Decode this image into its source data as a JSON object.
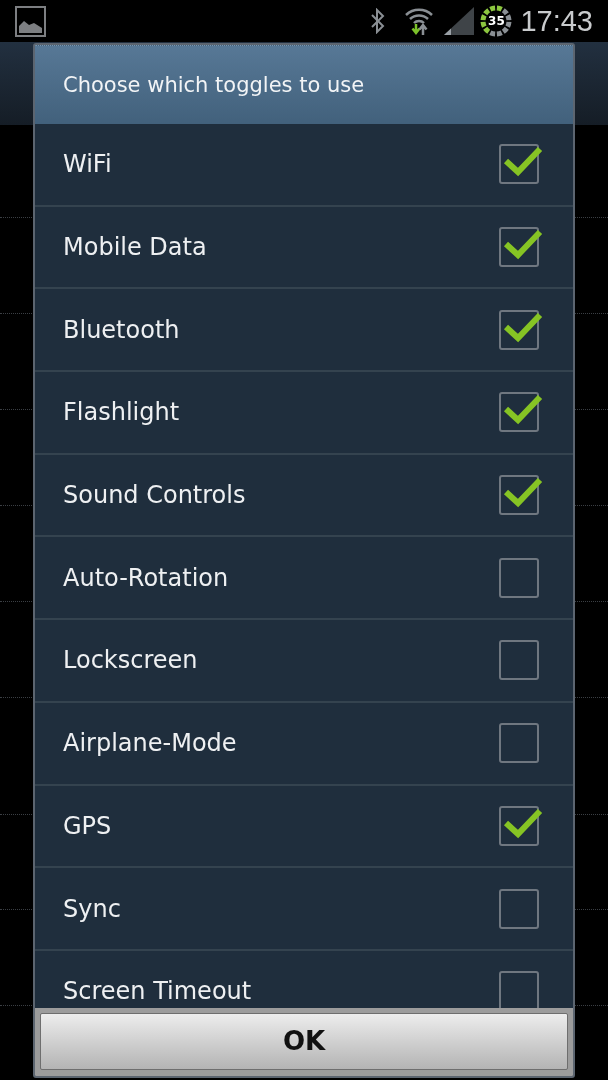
{
  "status_bar": {
    "battery": "35",
    "time": "17:43"
  },
  "dialog": {
    "title": "Choose which toggles to use",
    "toggles": [
      {
        "label": "WiFi",
        "checked": true
      },
      {
        "label": "Mobile Data",
        "checked": true
      },
      {
        "label": "Bluetooth",
        "checked": true
      },
      {
        "label": "Flashlight",
        "checked": true
      },
      {
        "label": "Sound Controls",
        "checked": true
      },
      {
        "label": "Auto-Rotation",
        "checked": false
      },
      {
        "label": "Lockscreen",
        "checked": false
      },
      {
        "label": "Airplane-Mode",
        "checked": false
      },
      {
        "label": "GPS",
        "checked": true
      },
      {
        "label": "Sync",
        "checked": false
      },
      {
        "label": "Screen Timeout",
        "checked": false
      }
    ],
    "ok_button": "OK"
  }
}
